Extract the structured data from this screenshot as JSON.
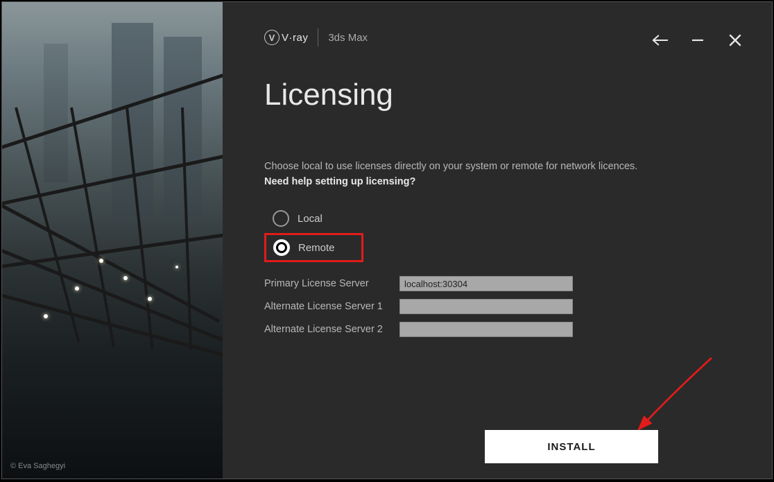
{
  "header": {
    "brand": "V·ray",
    "product": "3ds Max"
  },
  "title": "Licensing",
  "description": "Choose local to use licenses directly on your system or remote for network licences.",
  "help_link": "Need help setting up licensing?",
  "options": {
    "local": "Local",
    "remote": "Remote",
    "selected": "remote"
  },
  "servers": {
    "primary": {
      "label": "Primary License Server",
      "value": "localhost:30304"
    },
    "alt1": {
      "label": "Alternate License Server 1",
      "value": ""
    },
    "alt2": {
      "label": "Alternate License Server 2",
      "value": ""
    }
  },
  "install_button": "INSTALL",
  "credit": "© Eva Saghegyi"
}
